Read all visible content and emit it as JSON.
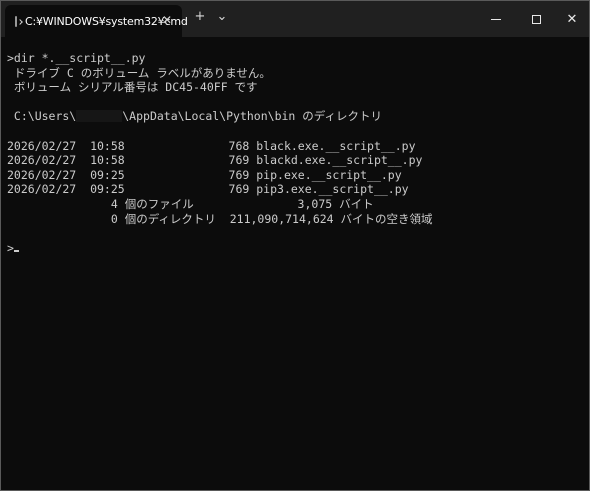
{
  "window": {
    "tab_title": "C:¥WINDOWS¥system32¥cmd",
    "tab_close": "✕",
    "new_tab": "+",
    "dropdown": "⌄",
    "close_glyph": "✕"
  },
  "terminal": {
    "command": ">dir *.__script__.py",
    "volume_line": " ドライブ C のボリューム ラベルがありません。",
    "serial_line": " ボリューム シリアル番号は DC45-40FF です",
    "dir_prefix": " C:\\Users\\",
    "dir_suffix": "\\AppData\\Local\\Python\\bin のディレクトリ",
    "files": [
      "2026/02/27  10:58               768 black.exe.__script__.py",
      "2026/02/27  10:58               769 blackd.exe.__script__.py",
      "2026/02/27  09:25               769 pip.exe.__script__.py",
      "2026/02/27  09:25               769 pip3.exe.__script__.py"
    ],
    "file_summary": "               4 個のファイル               3,075 バイト",
    "dir_summary": "               0 個のディレクトリ  211,090,714,624 バイトの空き領域",
    "prompt": ">"
  }
}
